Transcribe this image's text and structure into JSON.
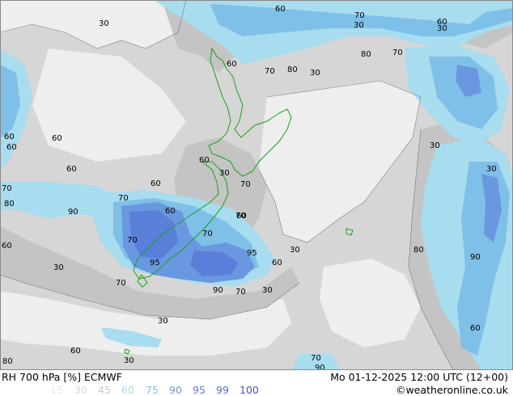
{
  "title_left": "RH 700 hPa [%] ECMWF",
  "title_right": "Mo 01-12-2025 12:00 UTC (12+00)",
  "copyright": "©weatheronline.co.uk",
  "legend": {
    "levels": [
      "15",
      "30",
      "45",
      "60",
      "75",
      "90",
      "95",
      "99",
      "100"
    ],
    "colors": [
      "#e8e8e8",
      "#d8d8d8",
      "#c8c8c8",
      "#a8dcef",
      "#7fc0e8",
      "#6a98e0",
      "#5a7fd8",
      "#4f6bd0",
      "#3d56c8"
    ]
  },
  "contour_labels": [
    "30",
    "60",
    "70",
    "60",
    "30",
    "30",
    "80",
    "70",
    "60",
    "70",
    "80",
    "30",
    "60",
    "60",
    "60",
    "60",
    "70",
    "80",
    "70",
    "60",
    "60",
    "30",
    "70",
    "60",
    "60",
    "70",
    "70",
    "60",
    "90",
    "95",
    "70",
    "60",
    "70",
    "95",
    "90",
    "80",
    "60",
    "90",
    "70",
    "30",
    "30",
    "30",
    "60",
    "30",
    "80",
    "70",
    "90",
    "30",
    "30",
    "30",
    "60",
    "30",
    "70",
    "60",
    "80",
    "90",
    "80",
    "60",
    "30"
  ]
}
